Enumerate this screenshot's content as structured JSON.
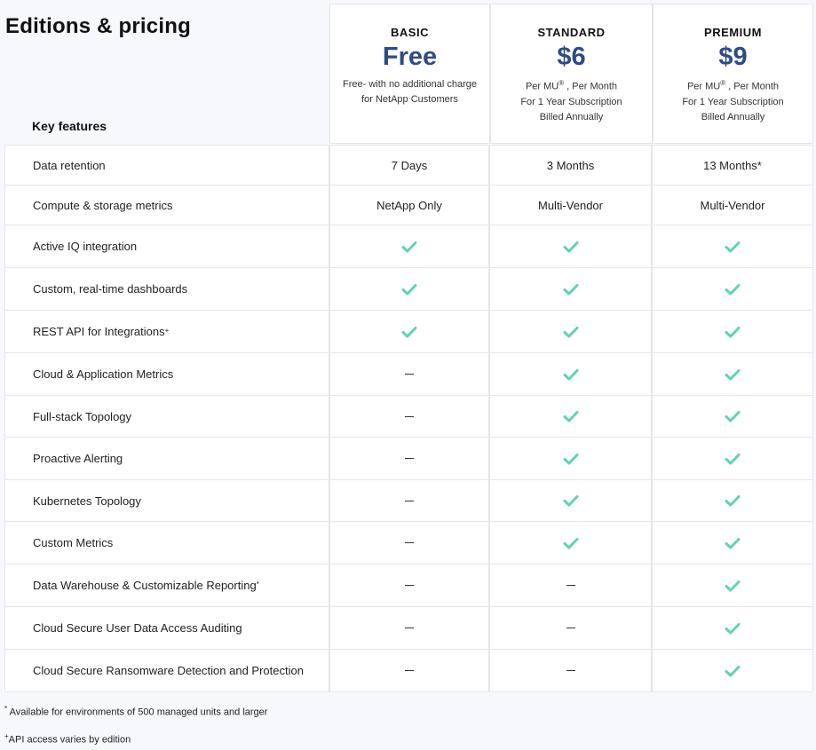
{
  "title": "Editions & pricing",
  "key_features_label": "Key features",
  "plans": [
    {
      "name": "BASIC",
      "price": "Free",
      "note_lines": [
        "Free- with no additional charge",
        "for NetApp Customers"
      ]
    },
    {
      "name": "STANDARD",
      "price": "$6",
      "note_prefix": "Per MU",
      "note_mark": "®",
      "note_suffix": " , Per Month",
      "note_lines": [
        "For 1 Year Subscription",
        "Billed Annually"
      ]
    },
    {
      "name": "PREMIUM",
      "price": "$9",
      "note_prefix": "Per MU",
      "note_mark": "®",
      "note_suffix": " , Per Month",
      "note_lines": [
        "For 1 Year Subscription",
        "Billed Annually"
      ]
    }
  ],
  "rows": [
    {
      "feature": "Data retention",
      "mark": "",
      "values": [
        "7 Days",
        "3 Months",
        "13 Months*"
      ]
    },
    {
      "feature": "Compute & storage metrics",
      "mark": "",
      "values": [
        "NetApp Only",
        "Multi-Vendor",
        "Multi-Vendor"
      ]
    },
    {
      "feature": "Active IQ integration",
      "mark": "",
      "values": [
        "check",
        "check",
        "check"
      ]
    },
    {
      "feature": "Custom, real-time dashboards",
      "mark": "",
      "values": [
        "check",
        "check",
        "check"
      ]
    },
    {
      "feature": "REST API for Integrations",
      "mark": "+",
      "values": [
        "check",
        "check",
        "check"
      ]
    },
    {
      "feature": "Cloud & Application Metrics",
      "mark": "",
      "values": [
        "dash",
        "check",
        "check"
      ]
    },
    {
      "feature": "Full-stack Topology",
      "mark": "",
      "values": [
        "dash",
        "check",
        "check"
      ]
    },
    {
      "feature": "Proactive Alerting",
      "mark": "",
      "values": [
        "dash",
        "check",
        "check"
      ]
    },
    {
      "feature": "Kubernetes Topology",
      "mark": "",
      "values": [
        "dash",
        "check",
        "check"
      ]
    },
    {
      "feature": "Custom Metrics",
      "mark": "",
      "values": [
        "dash",
        "check",
        "check"
      ]
    },
    {
      "feature": "Data Warehouse & Customizable Reporting",
      "mark": "*",
      "values": [
        "dash",
        "dash",
        "check"
      ]
    },
    {
      "feature": "Cloud Secure User Data Access Auditing",
      "mark": "",
      "values": [
        "dash",
        "dash",
        "check"
      ]
    },
    {
      "feature": "Cloud Secure Ransomware Detection and Protection",
      "mark": "",
      "values": [
        "dash",
        "dash",
        "check"
      ]
    }
  ],
  "footnotes": [
    {
      "mark": "*",
      "text": " Available for environments of 500 managed units and larger"
    },
    {
      "mark": "+",
      "text": "API access varies by edition"
    }
  ],
  "colors": {
    "check": "#5fd3b3",
    "price": "#2f4b86"
  }
}
